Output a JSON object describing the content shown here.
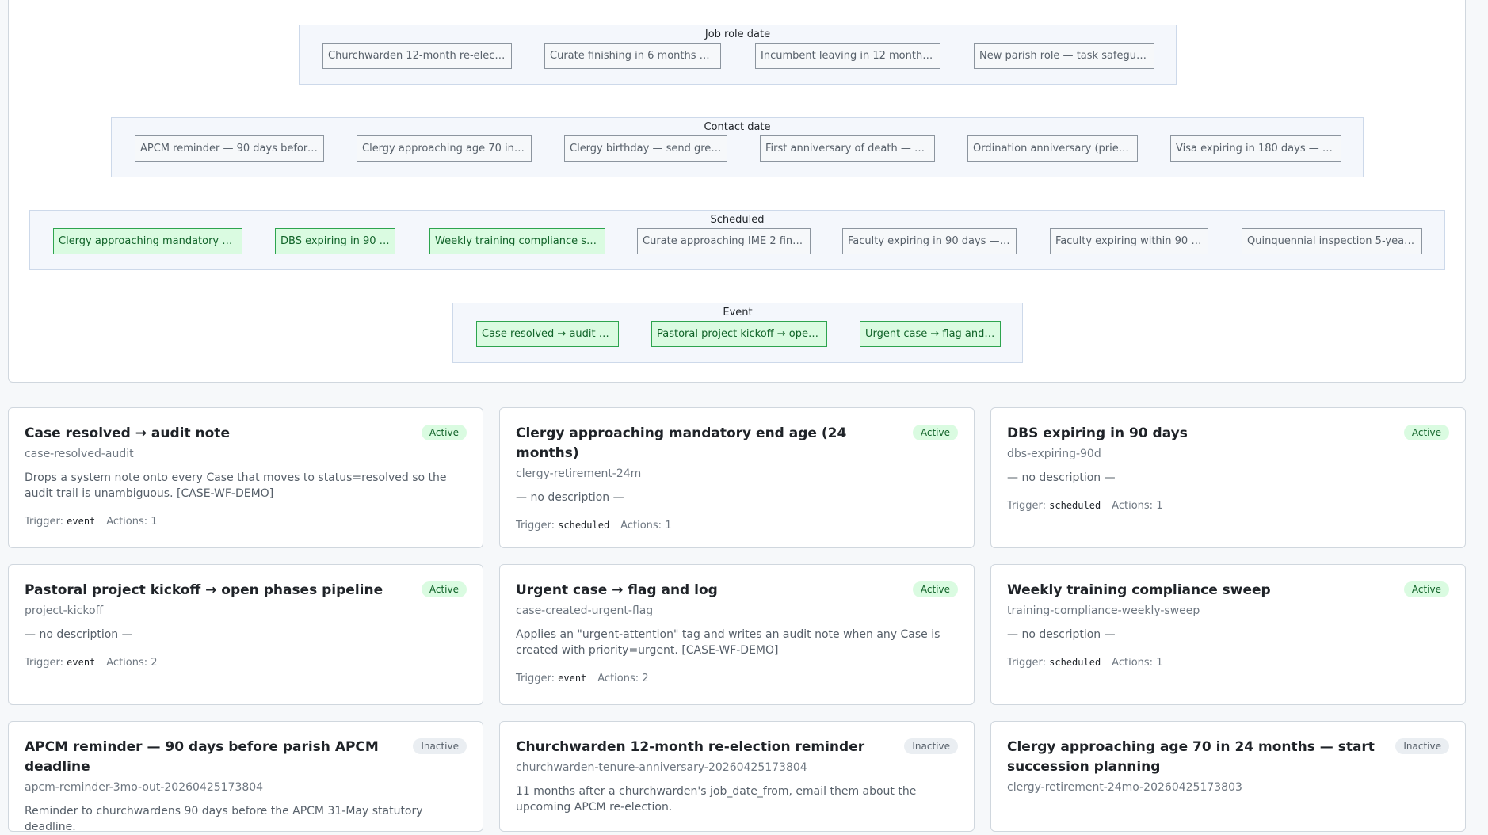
{
  "graph": {
    "groups": [
      {
        "title": "Job role date",
        "nodes": [
          {
            "label": "Churchwarden 12-month re-electio...",
            "active": false
          },
          {
            "label": "Curate finishing in 6 months — e...",
            "active": false
          },
          {
            "label": "Incumbent leaving in 12 months —...",
            "active": false
          },
          {
            "label": "New parish role — task safeguard...",
            "active": false
          }
        ]
      },
      {
        "title": "Contact date",
        "nodes": [
          {
            "label": "APCM reminder — 90 days before p...",
            "active": false
          },
          {
            "label": "Clergy approaching age 70 in 24...",
            "active": false
          },
          {
            "label": "Clergy birthday — send greeting",
            "active": false
          },
          {
            "label": "First anniversary of death — pas...",
            "active": false
          },
          {
            "label": "Ordination anniversary (priest)...",
            "active": false
          },
          {
            "label": "Visa expiring in 180 days — aler...",
            "active": false
          }
        ]
      },
      {
        "title": "Scheduled",
        "nodes": [
          {
            "label": "Clergy approaching mandatory end...",
            "active": true
          },
          {
            "label": "DBS expiring in 90 days",
            "active": true
          },
          {
            "label": "Weekly training compliance sweep",
            "active": true
          },
          {
            "label": "Curate approaching IME 2 finish...",
            "active": false
          },
          {
            "label": "Faculty expiring in 90 days — ta...",
            "active": false
          },
          {
            "label": "Faculty expiring within 90 days",
            "active": false
          },
          {
            "label": "Quinquennial inspection 5-year a...",
            "active": false
          }
        ]
      },
      {
        "title": "Event",
        "nodes": [
          {
            "label": "Case resolved → audit note",
            "active": true
          },
          {
            "label": "Pastoral project kickoff → open...",
            "active": true
          },
          {
            "label": "Urgent case → flag and log",
            "active": true
          }
        ]
      }
    ]
  },
  "labels": {
    "trigger": "Trigger:",
    "actions": "Actions:"
  },
  "workflows": [
    {
      "title": "Case resolved → audit note",
      "slug": "case-resolved-audit",
      "status": "Active",
      "description": "Drops a system note onto every Case that moves to status=resolved so the audit trail is unambiguous. [CASE-WF-DEMO]",
      "trigger": "event",
      "actions": "1"
    },
    {
      "title": "Clergy approaching mandatory end age (24 months)",
      "slug": "clergy-retirement-24m",
      "status": "Active",
      "description": "— no description —",
      "trigger": "scheduled",
      "actions": "1"
    },
    {
      "title": "DBS expiring in 90 days",
      "slug": "dbs-expiring-90d",
      "status": "Active",
      "description": "— no description —",
      "trigger": "scheduled",
      "actions": "1"
    },
    {
      "title": "Pastoral project kickoff → open phases pipeline",
      "slug": "project-kickoff",
      "status": "Active",
      "description": "— no description —",
      "trigger": "event",
      "actions": "2"
    },
    {
      "title": "Urgent case → flag and log",
      "slug": "case-created-urgent-flag",
      "status": "Active",
      "description": "Applies an \"urgent-attention\" tag and writes an audit note when any Case is created with priority=urgent. [CASE-WF-DEMO]",
      "trigger": "event",
      "actions": "2"
    },
    {
      "title": "Weekly training compliance sweep",
      "slug": "training-compliance-weekly-sweep",
      "status": "Active",
      "description": "— no description —",
      "trigger": "scheduled",
      "actions": "1"
    },
    {
      "title": "APCM reminder — 90 days before parish APCM deadline",
      "slug": "apcm-reminder-3mo-out-20260425173804",
      "status": "Inactive",
      "description": "Reminder to churchwardens 90 days before the APCM 31-May statutory deadline.",
      "trigger": "",
      "actions": ""
    },
    {
      "title": "Churchwarden 12-month re-election reminder",
      "slug": "churchwarden-tenure-anniversary-20260425173804",
      "status": "Inactive",
      "description": "11 months after a churchwarden's job_date_from, email them about the upcoming APCM re-election.",
      "trigger": "",
      "actions": ""
    },
    {
      "title": "Clergy approaching age 70 in 24 months — start succession planning",
      "slug": "clergy-retirement-24mo-20260425173803",
      "status": "Inactive",
      "description": "",
      "trigger": "",
      "actions": ""
    }
  ]
}
